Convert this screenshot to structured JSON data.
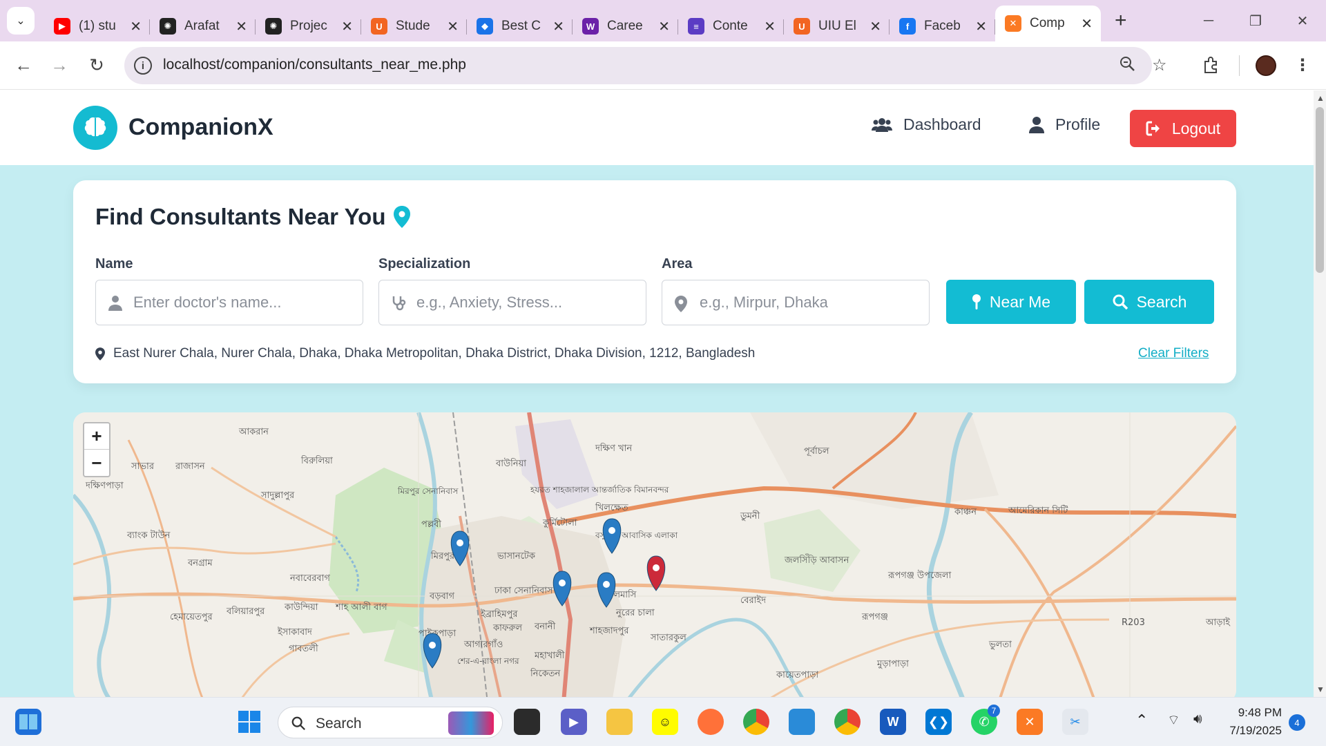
{
  "browser": {
    "tabs": [
      {
        "title": "(1) stu",
        "icon": "youtube-icon",
        "color": "#ff0000"
      },
      {
        "title": "Arafat",
        "icon": "openai-icon",
        "color": "#222222"
      },
      {
        "title": "Projec",
        "icon": "openai-icon",
        "color": "#222222"
      },
      {
        "title": "Stude",
        "icon": "uiu-icon",
        "color": "#f26522"
      },
      {
        "title": "Best C",
        "icon": "bookmark-icon",
        "color": "#1a73e8"
      },
      {
        "title": "Caree",
        "icon": "w-icon",
        "color": "#6b21a8"
      },
      {
        "title": "Conte",
        "icon": "list-icon",
        "color": "#5b3cc4"
      },
      {
        "title": "UIU El",
        "icon": "uiu-icon",
        "color": "#f26522"
      },
      {
        "title": "Faceb",
        "icon": "facebook-icon",
        "color": "#1877f2"
      },
      {
        "title": "Comp",
        "icon": "xampp-icon",
        "color": "#fb7a24"
      }
    ],
    "url": "localhost/companion/consultants_near_me.php"
  },
  "header": {
    "brand": "CompanionX",
    "nav": {
      "dashboard": "Dashboard",
      "profile": "Profile",
      "logout": "Logout"
    }
  },
  "search_card": {
    "title": "Find Consultants Near You",
    "name_label": "Name",
    "name_placeholder": "Enter doctor's name...",
    "spec_label": "Specialization",
    "spec_placeholder": "e.g., Anxiety, Stress...",
    "area_label": "Area",
    "area_placeholder": "e.g., Mirpur, Dhaka",
    "near_me": "Near Me",
    "search": "Search",
    "location": "East Nurer Chala, Nurer Chala, Dhaka, Dhaka Metropolitan, Dhaka District, Dhaka Division, 1212, Bangladesh",
    "clear": "Clear Filters"
  },
  "map": {
    "zoom_in": "+",
    "zoom_out": "−",
    "places": [
      {
        "name": "আকরান"
      },
      {
        "name": "সাভার"
      },
      {
        "name": "রাজাসন"
      },
      {
        "name": "দক্ষিণপাড়া"
      },
      {
        "name": "বিরুলিয়া"
      },
      {
        "name": "সাদুল্লাপুর"
      },
      {
        "name": "মিরপুর সেনানিবাস"
      },
      {
        "name": "বাউনিয়া"
      },
      {
        "name": "দক্ষিণ খান"
      },
      {
        "name": "পূর্বাচল"
      },
      {
        "name": "হযরত শাহজালাল আন্তর্জাতিক বিমানবন্দর"
      },
      {
        "name": "খিলক্ষেত"
      },
      {
        "name": "কুর্মিটোলা"
      },
      {
        "name": "ডুমনী"
      },
      {
        "name": "কাঞ্চন"
      },
      {
        "name": "আমেরিকান সিটি"
      },
      {
        "name": "পল্লবী"
      },
      {
        "name": "ব্যাংক টাউন"
      },
      {
        "name": "বনগ্রাম"
      },
      {
        "name": "নবাবেরবাগ"
      },
      {
        "name": "মিরপুর"
      },
      {
        "name": "ভাসানটেক"
      },
      {
        "name": "বসুন্ধরা আবাসিক এলাকা"
      },
      {
        "name": "জলসিঁড়ি আবাসন"
      },
      {
        "name": "রূপগঞ্জ উপজেলা"
      },
      {
        "name": "হেমায়েতপুর"
      },
      {
        "name": "বলিয়ারপুর"
      },
      {
        "name": "কাউন্দিয়া"
      },
      {
        "name": "শাহ আলী বাগ"
      },
      {
        "name": "বড়বাগ"
      },
      {
        "name": "ঢাকা সেনানিবাস"
      },
      {
        "name": "ইব্রাহিমপুর"
      },
      {
        "name": "কাফরুল"
      },
      {
        "name": "বনানী"
      },
      {
        "name": "নুরের চালা"
      },
      {
        "name": "শাহজাদপুর"
      },
      {
        "name": "সাতারকুল"
      },
      {
        "name": "বেরাইদ"
      },
      {
        "name": "রূপগঞ্জ"
      },
      {
        "name": "R203"
      },
      {
        "name": "আড়াই"
      },
      {
        "name": "ইসাকাবাদ"
      },
      {
        "name": "পাইকপাড়া"
      },
      {
        "name": "আগারগাঁও"
      },
      {
        "name": "শের-এ-বাংলা নগর"
      },
      {
        "name": "মহাখালী"
      },
      {
        "name": "নিকেতন"
      },
      {
        "name": "গাবতলী"
      },
      {
        "name": "কায়েতপাড়া"
      },
      {
        "name": "মুড়াপাড়া"
      },
      {
        "name": "ভুলতা"
      },
      {
        "name": "সালমাসি"
      }
    ]
  },
  "taskbar": {
    "search": "Search",
    "time": "9:48 PM",
    "date": "7/19/2025",
    "notifications": "4",
    "vscode_badge": "7"
  }
}
